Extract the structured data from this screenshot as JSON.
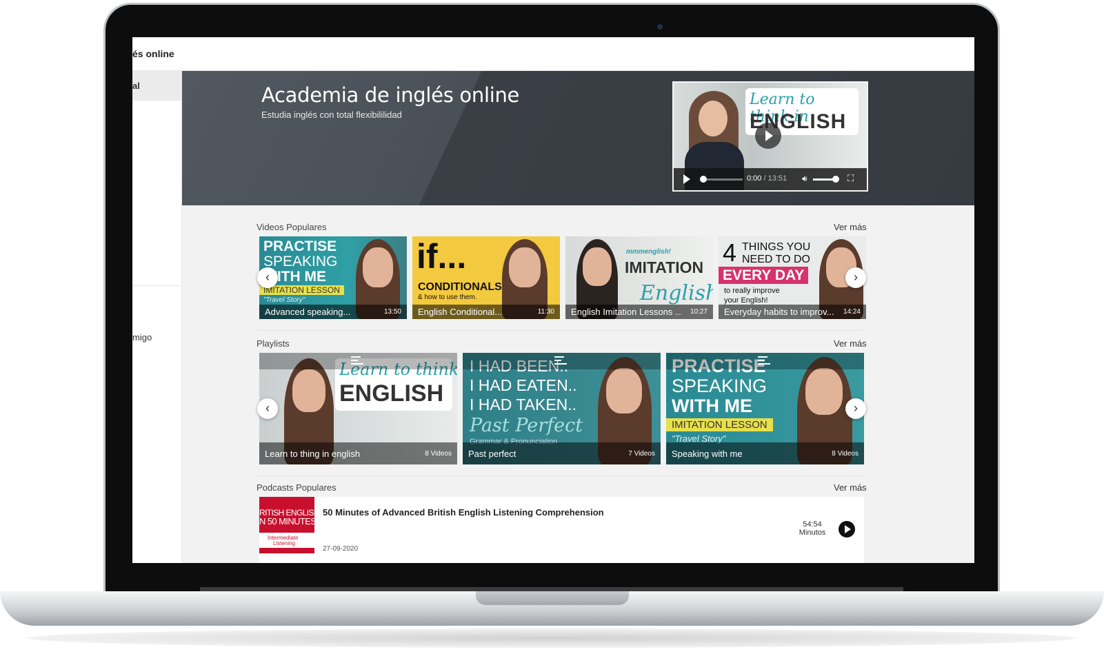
{
  "app": {
    "brand": "és online"
  },
  "sidebar": {
    "active_label": "al",
    "friend_label": "migo"
  },
  "hero": {
    "title": "Academia de inglés online",
    "subtitle": "Estudia inglés con total flexibililidad"
  },
  "player": {
    "thumb_line1": "Learn to think in",
    "thumb_line2": "ENGLISH",
    "current_time": "0:00",
    "separator": " / ",
    "duration": "13:51"
  },
  "sections": {
    "videos": {
      "title": "Videos Populares",
      "see_more": "Ver más"
    },
    "playlists": {
      "title": "Playlists",
      "see_more": "Ver más"
    },
    "podcasts": {
      "title": "Podcasts Populares",
      "see_more": "Ver más"
    }
  },
  "videos": [
    {
      "title": "Advanced speaking...",
      "duration": "13:50",
      "art_lines": [
        "PRACTISE",
        "SPEAKING",
        "WITH ME",
        "IMITATION LESSON",
        "\"Travel Story\""
      ]
    },
    {
      "title": "English Conditional...",
      "duration": "11:30",
      "art_lines": [
        "if...",
        "CONDITIONALS",
        "& how to use them."
      ]
    },
    {
      "title": "English Imitation Lessons ...",
      "duration": "10:27",
      "art_lines": [
        "mmmenglish!",
        "IMITATION",
        "English"
      ]
    },
    {
      "title": "Everyday habits to improv...",
      "duration": "14:24",
      "art_lines": [
        "4",
        "THINGS YOU",
        "NEED TO DO",
        "EVERY DAY",
        "to really improve",
        "your English!"
      ]
    }
  ],
  "playlists": [
    {
      "title": "Learn to thing in english",
      "count": "8 Videos",
      "art_lines": [
        "Learn to think in",
        "ENGLISH"
      ]
    },
    {
      "title": "Past perfect",
      "count": "7 Videos",
      "art_lines": [
        "I HAD BEEN..",
        "I HAD EATEN..",
        "I HAD TAKEN..",
        "Past Perfect",
        "Grammar & Pronunciation"
      ]
    },
    {
      "title": "Speaking with me",
      "count": "8 Videos",
      "art_lines": [
        "PRACTISE",
        "SPEAKING",
        "WITH ME",
        "IMITATION LESSON",
        "\"Travel Story\""
      ]
    }
  ],
  "podcast": {
    "title": "50 Minutes of Advanced British English Listening Comprehension",
    "date": "27-09-2020",
    "duration": "54:54",
    "duration_unit": "Minutos",
    "art_lines": [
      "RITISH ENGLISH",
      "N 50 MINUTES",
      "Intermediate",
      "Listening"
    ]
  },
  "nav": {
    "prev": "‹",
    "next": "›"
  },
  "colors": {
    "hero_bg": "#3a3f46",
    "teal": "#2a9fa8",
    "yellow": "#f5c842",
    "pink": "#d6336c",
    "podcast_red": "#c8102e"
  }
}
